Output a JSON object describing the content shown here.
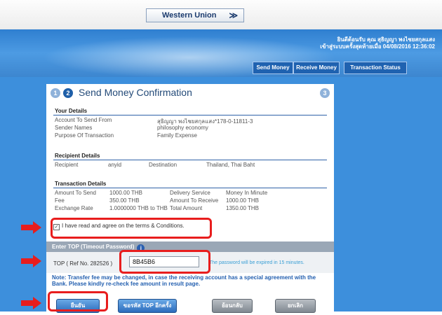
{
  "header": {
    "service": "Western Union",
    "user_line1": "ยินดีต้อนรับ คุณ สุธิญญา พงไชยสกุลแสง",
    "user_line2": "เข้าสู่ระบบครั้งสุดท้ายเมื่อ 04/08/2016 12:36:02"
  },
  "tabs": [
    "Send Money",
    "Receive Money",
    "Transaction Status"
  ],
  "page": {
    "steps": [
      "1",
      "2",
      "3"
    ],
    "title": "Send Money Confirmation"
  },
  "your_details": {
    "title": "Your Details",
    "rows": [
      {
        "label": "Account To Send From",
        "value": "สุธิญญา พงไชยสกุลแสง*178-0-11811-3"
      },
      {
        "label": "Sender Names",
        "value": "philosophy economy"
      },
      {
        "label": "Purpose Of Transaction",
        "value": "Family Expense"
      }
    ]
  },
  "recipient_details": {
    "title": "Recipient Details",
    "recipient_label": "Recipient",
    "recipient_value": "anyid",
    "destination_label": "Destination",
    "destination_value": "Thailand, Thai Baht"
  },
  "transaction_details": {
    "title": "Transaction Details",
    "rows": [
      {
        "l1": "Amount To Send",
        "v1": "1000.00 THB",
        "l2": "Delivery Service",
        "v2": "Money In Minute"
      },
      {
        "l1": "Fee",
        "v1": "350.00 THB",
        "l2": "Amount To Receive",
        "v2": "1000.00 THB"
      },
      {
        "l1": "Exchange Rate",
        "v1": "1.0000000 THB to THB",
        "l2": "Total Amount",
        "v2": "1350.00 THB"
      }
    ]
  },
  "terms": {
    "checked": true,
    "check_mark": "✓",
    "label": "I have read and agree on the terms & Conditions."
  },
  "otp": {
    "bar_title": "Enter TOP (Timeout Password)",
    "info_icon": "i",
    "label": "TOP ( Ref No. 282526 )",
    "value": "8B45B6",
    "expire_text": "The password will be expired in 15 minutes."
  },
  "note": "Note: Transfer fee may be changed, in case the receiving account has a special agreement with the Bank. Please kindly re-check fee amount in result page.",
  "buttons": {
    "confirm": "ยืนยัน",
    "resend": "ขอรหัส TOP อีกครั้ง",
    "back": "ย้อนกลับ",
    "cancel": "ยกเลิก"
  },
  "colors": {
    "highlight": "#e81d1d",
    "banner": "#3d8fdc",
    "title": "#234a78"
  }
}
